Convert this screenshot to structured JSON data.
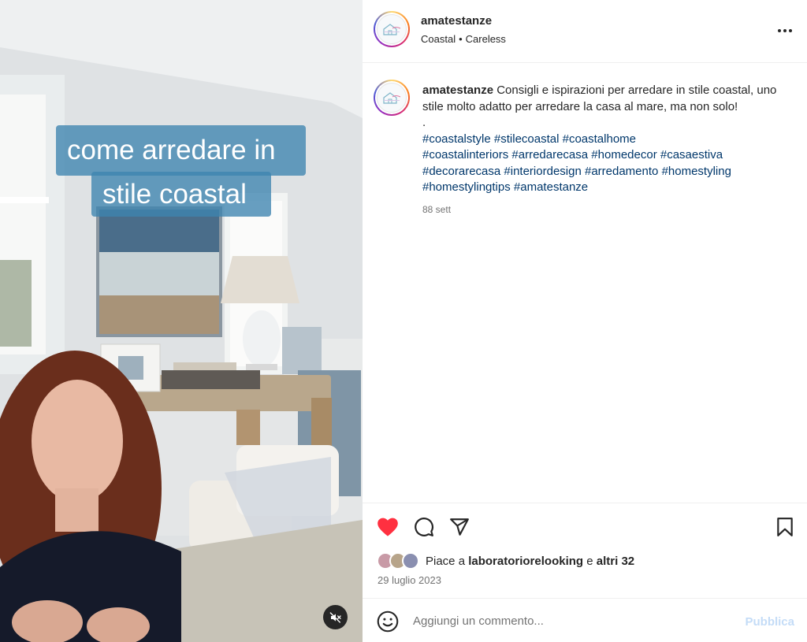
{
  "media": {
    "overlay_line1": "come arredare in",
    "overlay_line2": "stile coastal",
    "mute_icon": "speaker-muted-icon"
  },
  "header": {
    "username": "amatestanze",
    "audio_artist": "Coastal",
    "separator": "•",
    "audio_track": "Careless",
    "more_icon": "more-horizontal-icon"
  },
  "caption": {
    "username": "amatestanze",
    "text": "Consigli e ispirazioni per arredare in stile coastal, uno stile molto adatto per arredare la casa al mare, ma non solo!",
    "dot": ".",
    "hashtags": [
      "#coastalstyle",
      "#stilecoastal",
      "#coastalhome",
      "#coastalinteriors",
      "#arredarecasa",
      "#homedecor",
      "#casaestiva",
      "#decorarecasa",
      "#interiordesign",
      "#arredamento",
      "#homestyling",
      "#homestylingtips",
      "#amatestanze"
    ],
    "time": "88 sett"
  },
  "actions": {
    "like_icon": "heart-filled-icon",
    "comment_icon": "comment-icon",
    "share_icon": "paper-plane-icon",
    "save_icon": "bookmark-icon",
    "liked_color": "#ff3040"
  },
  "likes": {
    "prefix": "Piace a",
    "first_liker": "laboratoriorelooking",
    "connector": "e",
    "others": "altri 32"
  },
  "post_date": "29 luglio 2023",
  "comment": {
    "placeholder": "Aggiungi un commento...",
    "publish_label": "Pubblica",
    "emoji_icon": "smiley-icon"
  },
  "colors": {
    "hashtag": "#00376b",
    "overlay": "#3e84b0",
    "publish_disabled": "#c4dcf7"
  }
}
